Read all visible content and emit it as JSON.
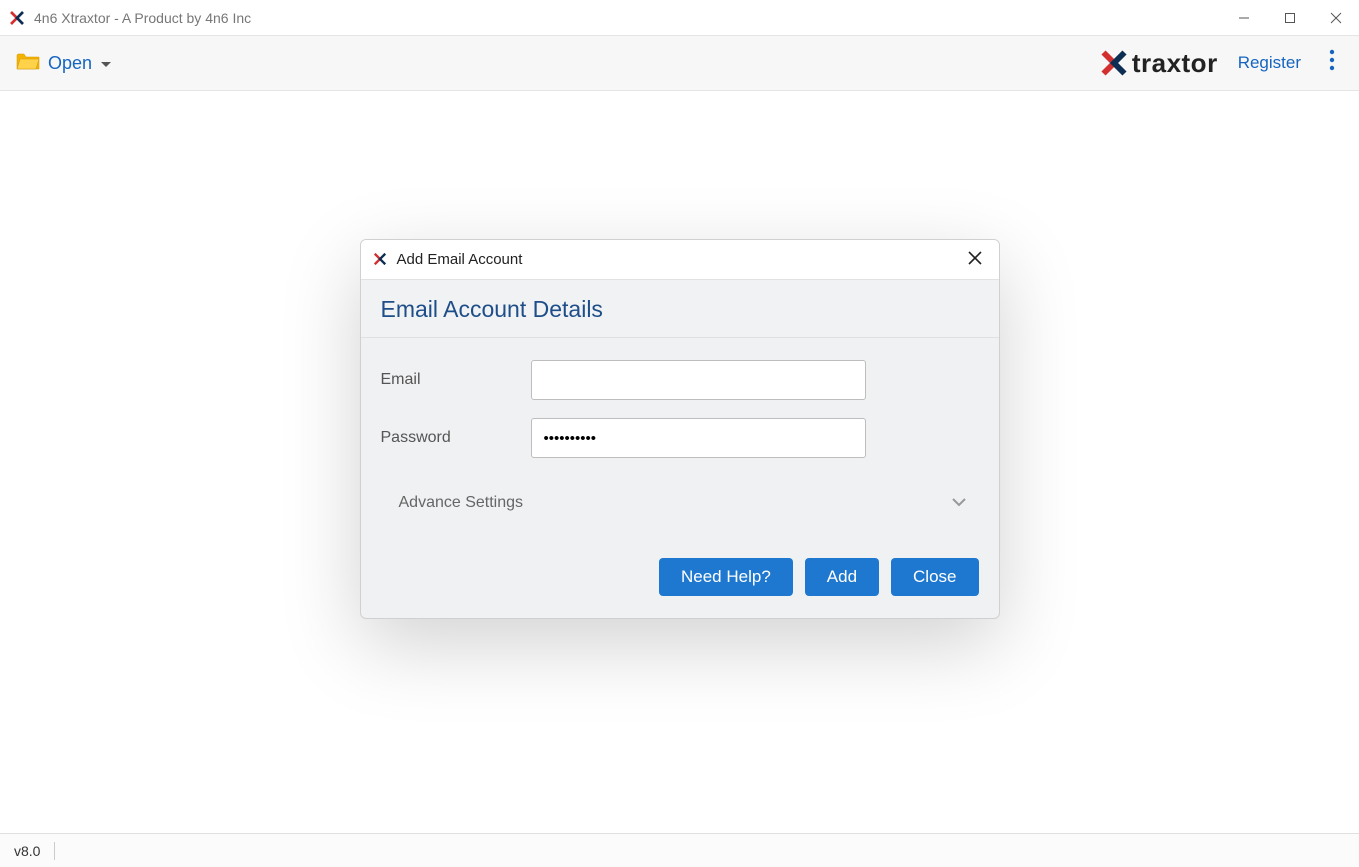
{
  "window": {
    "title": "4n6 Xtraxtor - A Product by 4n6 Inc"
  },
  "toolbar": {
    "open_label": "Open",
    "register_label": "Register",
    "brand": "traxtor"
  },
  "dialog": {
    "title": "Add Email Account",
    "header": "Email Account Details",
    "email_label": "Email",
    "email_value": "",
    "password_label": "Password",
    "password_value": "••••••••••",
    "advance_label": "Advance Settings",
    "buttons": {
      "help": "Need Help?",
      "add": "Add",
      "close": "Close"
    }
  },
  "status": {
    "version": "v8.0"
  }
}
